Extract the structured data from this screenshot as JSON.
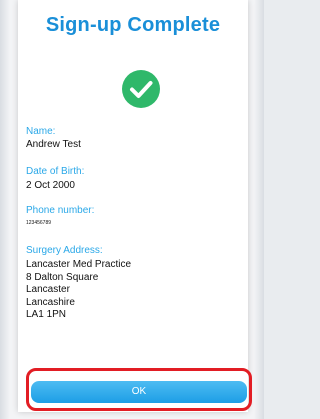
{
  "screen": {
    "title": "Sign-up Complete",
    "success_icon": "check-circle-icon",
    "accent_color": "#1a8fd8",
    "success_color": "#2fb86a",
    "highlight_color": "#e21d24"
  },
  "fields": {
    "name": {
      "label": "Name:",
      "value": "Andrew Test"
    },
    "dob": {
      "label": "Date of Birth:",
      "value": "2 Oct 2000"
    },
    "phone": {
      "label": "Phone number:",
      "value": "123456789"
    },
    "address": {
      "label": "Surgery Address:",
      "lines": [
        "Lancaster Med Practice",
        "8 Dalton Square",
        "Lancaster",
        "Lancashire",
        "LA1 1PN"
      ]
    }
  },
  "actions": {
    "ok_label": "OK"
  }
}
